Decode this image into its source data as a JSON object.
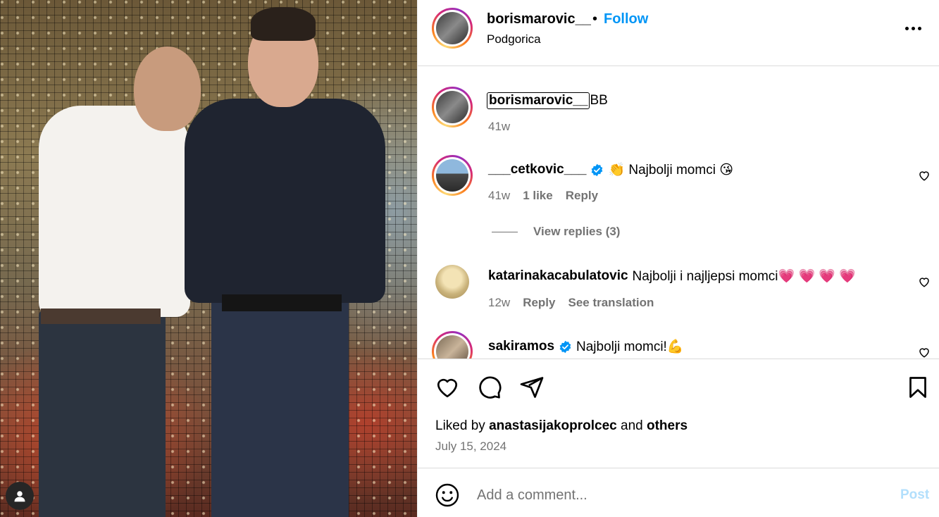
{
  "post": {
    "image_alt": "Two men posing in front of a sequin wall"
  },
  "header": {
    "username": "borismarovic__",
    "separator": "•",
    "follow_label": "Follow",
    "location": "Podgorica",
    "more_icon": "more-horizontal-icon"
  },
  "caption": {
    "username": "borismarovic__",
    "text": "BB",
    "time": "41w"
  },
  "comments": [
    {
      "username": "___cetkovic___",
      "verified": true,
      "text": "👏 Najbolji momci 😘",
      "time": "41w",
      "likes": "1 like",
      "reply_label": "Reply",
      "view_replies": "View replies (3)"
    },
    {
      "username": "katarinakacabulatovic",
      "verified": false,
      "text": "Najbolji i najljepsi momci💗 💗 💗 💗",
      "time": "12w",
      "reply_label": "Reply",
      "translate_label": "See translation"
    },
    {
      "username": "sakiramos",
      "verified": true,
      "text": "Najbolji momci!💪"
    }
  ],
  "actions": {
    "like_icon": "heart-icon",
    "comment_icon": "comment-icon",
    "share_icon": "send-icon",
    "save_icon": "bookmark-icon"
  },
  "likes": {
    "prefix": "Liked by",
    "user": "anastasijakoprolcec",
    "conj": "and",
    "others": "others"
  },
  "date": "July 15, 2024",
  "add_comment": {
    "placeholder": "Add a comment...",
    "post_label": "Post",
    "emoji_icon": "emoji-icon"
  },
  "colors": {
    "accent": "#0095f6",
    "post_disabled": "#b2dffc",
    "muted": "#737373",
    "heart_pink": "#ff3b6b"
  }
}
